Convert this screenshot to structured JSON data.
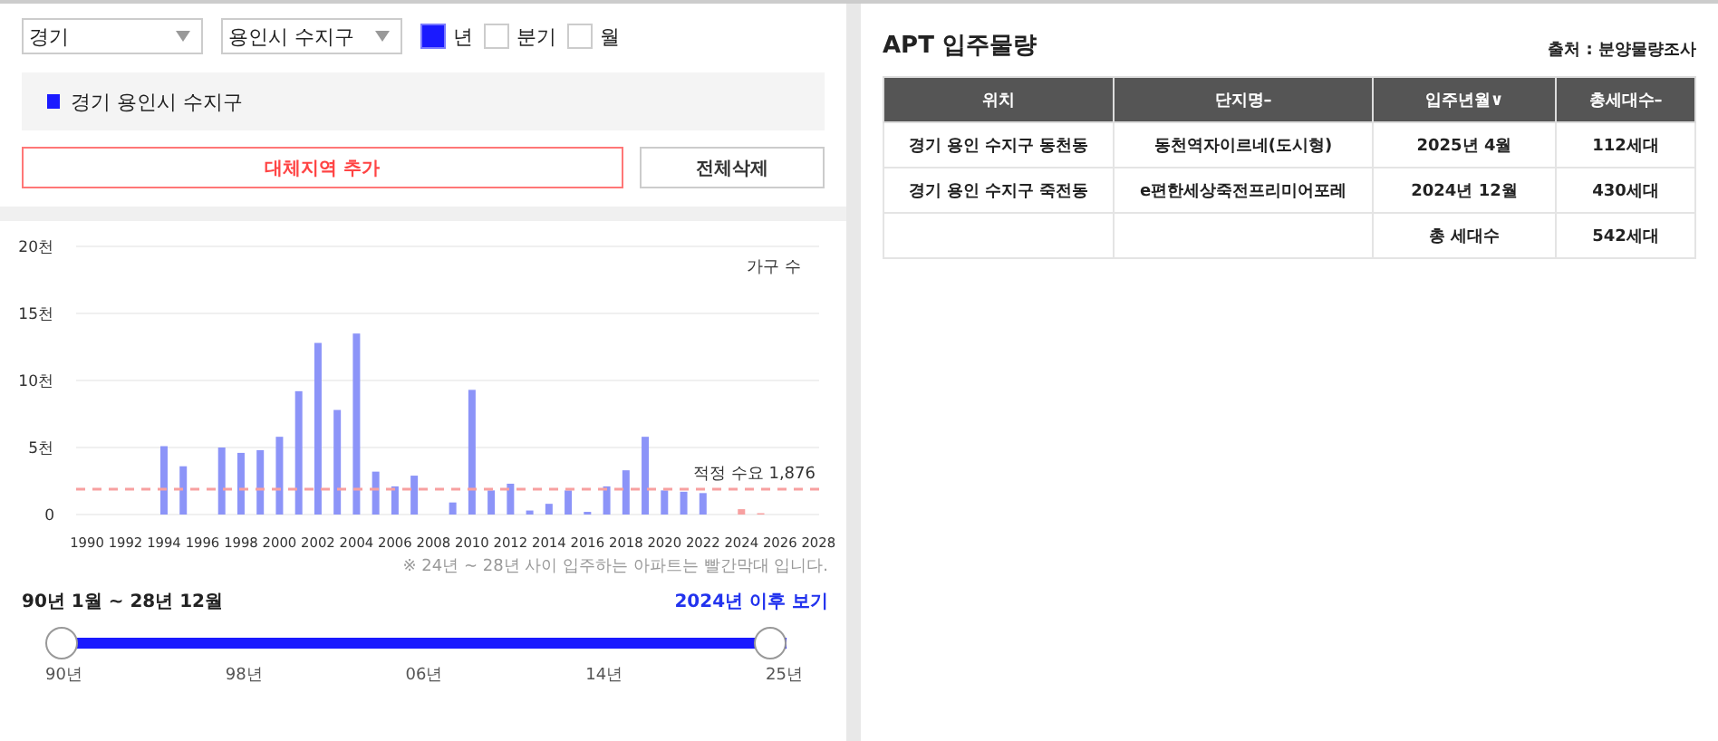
{
  "filters": {
    "province": "경기",
    "city": "용인시 수지구",
    "periods": [
      {
        "label": "년",
        "selected": true
      },
      {
        "label": "분기",
        "selected": false
      },
      {
        "label": "월",
        "selected": false
      }
    ]
  },
  "legend": {
    "label": "경기 용인시 수지구",
    "color": "#1a1aff"
  },
  "buttons": {
    "add": "대체지역 추가",
    "clear": "전체삭제"
  },
  "chart": {
    "chart_data": {
      "type": "bar",
      "ylabel": "가구 수",
      "categories": [
        "1990",
        null,
        "1992",
        null,
        "1994",
        null,
        "1996",
        null,
        "1998",
        null,
        "2000",
        null,
        "2002",
        null,
        "2004",
        null,
        "2006",
        null,
        "2008",
        null,
        "2010",
        null,
        "2012",
        null,
        "2014",
        null,
        "2016",
        null,
        "2018",
        null,
        "2020",
        null,
        "2022",
        null,
        "2024",
        null,
        "2026",
        null,
        "2028"
      ],
      "stacked": true,
      "series": [
        {
          "color": "#8c94f8",
          "values": [
            0,
            0,
            0,
            0,
            5.1,
            3.6,
            0,
            5.0,
            4.6,
            4.8,
            5.8,
            9.2,
            12.8,
            7.8,
            13.5,
            3.2,
            2.1,
            2.9,
            0,
            0.9,
            9.3,
            1.8,
            2.3,
            0.3,
            0.8,
            1.8,
            0.2,
            2.1,
            3.3,
            5.8,
            1.8,
            1.7,
            1.6,
            0,
            null,
            null,
            null,
            null,
            null
          ]
        },
        {
          "color": "#f7a0a0",
          "values": [
            null,
            null,
            null,
            null,
            null,
            null,
            null,
            null,
            null,
            null,
            null,
            null,
            null,
            null,
            null,
            null,
            null,
            null,
            null,
            null,
            null,
            null,
            null,
            null,
            null,
            null,
            null,
            null,
            null,
            null,
            null,
            null,
            null,
            null,
            0.4,
            0.1,
            0,
            0,
            0
          ]
        }
      ],
      "ylim": [
        0,
        20
      ],
      "yticks": [
        {
          "value": 0,
          "label": "0"
        },
        {
          "value": 5,
          "label": "5천"
        },
        {
          "value": 10,
          "label": "10천"
        },
        {
          "value": 15,
          "label": "15천"
        },
        {
          "value": 20,
          "label": "20천"
        }
      ],
      "grid": true,
      "ref_lines": [
        {
          "axis": "y",
          "value": 1.9,
          "label": "적정 수요 1,876"
        }
      ]
    },
    "note": "※ 24년 ~ 28년 사이 입주하는 아파트는 빨간막대 입니다."
  },
  "range": {
    "label": "90년 1월 ~ 28년 12월",
    "link": "2024년 이후 보기",
    "level": 1,
    "ticks": [
      "90년",
      "98년",
      "06년",
      "14년",
      "25년"
    ]
  },
  "apt": {
    "title": "APT 입주물량",
    "source": "출처 : 분양물량조사",
    "columns": [
      {
        "label": "위치"
      },
      {
        "label": "단지명",
        "sort": "–"
      },
      {
        "label": "입주년월",
        "sort": "∨"
      },
      {
        "label": "총세대수",
        "sort": "–"
      }
    ],
    "rows": [
      [
        "경기 용인 수지구 동천동",
        "동천역자이르네(도시형)",
        "2025년 4월",
        "112세대"
      ],
      [
        "경기 용인 수지구 죽전동",
        "e편한세상죽전프리미어포레",
        "2024년 12월",
        "430세대"
      ],
      [
        "",
        "",
        "총 세대수",
        "542세대"
      ]
    ]
  }
}
